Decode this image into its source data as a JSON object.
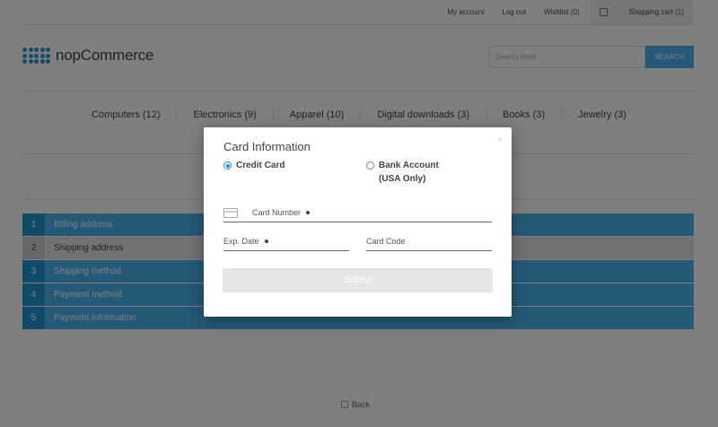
{
  "header": {
    "links": [
      "My account",
      "Log out",
      "Wishlist (0)"
    ],
    "cart": "Shopping cart (1)",
    "logo_text": "nopCommerce",
    "search_placeholder": "Search store",
    "search_button": "SEARCH"
  },
  "menu": [
    "Computers (12)",
    "Electronics (9)",
    "Apparel (10)",
    "Digital downloads (3)",
    "Books (3)",
    "Jewelry (3)"
  ],
  "steps": [
    {
      "num": "1",
      "label": "Billing address"
    },
    {
      "num": "2",
      "label": "Shipping address"
    },
    {
      "num": "3",
      "label": "Shipping method"
    },
    {
      "num": "4",
      "label": "Payment method"
    },
    {
      "num": "5",
      "label": "Payment information"
    }
  ],
  "back_label": "Back",
  "modal": {
    "title": "Card Information",
    "close": "×",
    "option_credit": "Credit Card",
    "option_bank_line1": "Bank Account",
    "option_bank_line2": "(USA Only)",
    "card_number_label": "Card Number",
    "exp_date_label": "Exp. Date",
    "card_code_label": "Card Code",
    "submit_label": "Submit"
  },
  "colors": {
    "accent": "#4ab2f1",
    "accent_dark": "#2196d3",
    "overlay": "rgba(0,0,0,0.5)",
    "radio_selected": "#1b8ed1"
  }
}
